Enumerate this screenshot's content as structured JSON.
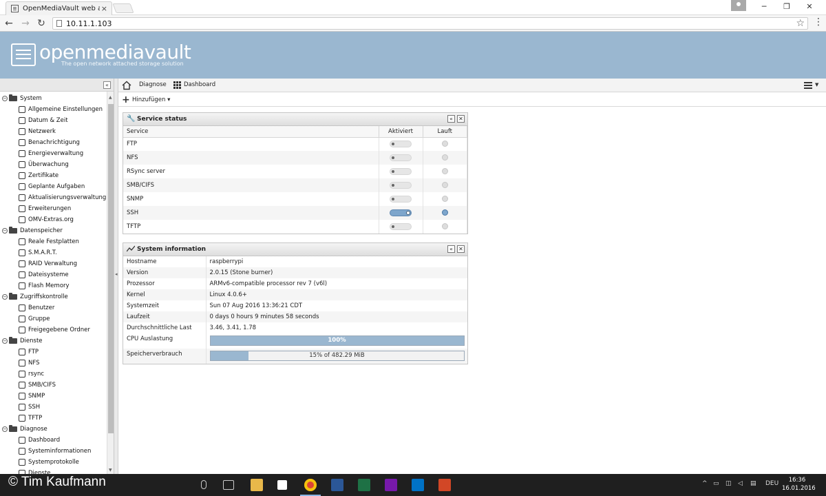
{
  "browser": {
    "tab_title": "OpenMediaVault web administration",
    "close_glyph": "×",
    "url": "10.11.1.103",
    "back_glyph": "←",
    "forward_glyph": "→",
    "reload_glyph": "↻",
    "star_glyph": "☆",
    "menu_glyph": "⋮",
    "minimize_glyph": "─",
    "restore_glyph": "❐",
    "window_close_glyph": "✕"
  },
  "header": {
    "logo_text": "openmediavault",
    "tagline": "The open network attached storage solution"
  },
  "sidebar": {
    "collapse_glyph": "«",
    "groups": [
      {
        "label": "System",
        "items": [
          {
            "label": "Allgemeine Einstellungen",
            "icon": "gears-icon"
          },
          {
            "label": "Datum & Zeit",
            "icon": "clock-icon"
          },
          {
            "label": "Netzwerk",
            "icon": "network-icon"
          },
          {
            "label": "Benachrichtigung",
            "icon": "mail-icon"
          },
          {
            "label": "Energieverwaltung",
            "icon": "power-icon"
          },
          {
            "label": "Überwachung",
            "icon": "chart-line-icon"
          },
          {
            "label": "Zertifikate",
            "icon": "certificate-icon"
          },
          {
            "label": "Geplante Aufgaben",
            "icon": "alarm-icon"
          },
          {
            "label": "Aktualisierungsverwaltung",
            "icon": "update-icon"
          },
          {
            "label": "Erweiterungen",
            "icon": "puzzle-icon"
          },
          {
            "label": "OMV-Extras.org",
            "icon": "plug-icon"
          }
        ]
      },
      {
        "label": "Datenspeicher",
        "items": [
          {
            "label": "Reale Festplatten",
            "icon": "disk-icon"
          },
          {
            "label": "S.M.A.R.T.",
            "icon": "smart-icon"
          },
          {
            "label": "RAID Verwaltung",
            "icon": "raid-icon"
          },
          {
            "label": "Dateisysteme",
            "icon": "filesystem-icon"
          },
          {
            "label": "Flash Memory",
            "icon": "flash-icon"
          }
        ]
      },
      {
        "label": "Zugriffskontrolle",
        "items": [
          {
            "label": "Benutzer",
            "icon": "user-icon"
          },
          {
            "label": "Gruppe",
            "icon": "group-icon"
          },
          {
            "label": "Freigegebene Ordner",
            "icon": "share-icon"
          }
        ]
      },
      {
        "label": "Dienste",
        "items": [
          {
            "label": "FTP",
            "icon": "ftp-icon"
          },
          {
            "label": "NFS",
            "icon": "nfs-icon"
          },
          {
            "label": "rsync",
            "icon": "rsync-icon"
          },
          {
            "label": "SMB/CIFS",
            "icon": "windows-icon"
          },
          {
            "label": "SNMP",
            "icon": "snmp-icon"
          },
          {
            "label": "SSH",
            "icon": "terminal-icon"
          },
          {
            "label": "TFTP",
            "icon": "tftp-icon"
          }
        ]
      },
      {
        "label": "Diagnose",
        "items": [
          {
            "label": "Dashboard",
            "icon": "grid-icon"
          },
          {
            "label": "Systeminformationen",
            "icon": "chart-line-icon"
          },
          {
            "label": "Systemprotokolle",
            "icon": "log-icon"
          },
          {
            "label": "Dienste",
            "icon": "services-icon"
          }
        ]
      }
    ]
  },
  "breadcrumb": {
    "items": [
      "Diagnose",
      "Dashboard"
    ]
  },
  "toolbar": {
    "add_label": "Hinzufügen",
    "add_caret": "▾",
    "plus_glyph": "+"
  },
  "service_status": {
    "title": "Service status",
    "columns": [
      "Service",
      "Aktiviert",
      "Lauft"
    ],
    "rows": [
      {
        "service": "FTP",
        "enabled": false,
        "running": false
      },
      {
        "service": "NFS",
        "enabled": false,
        "running": false
      },
      {
        "service": "RSync server",
        "enabled": false,
        "running": false
      },
      {
        "service": "SMB/CIFS",
        "enabled": false,
        "running": false
      },
      {
        "service": "SNMP",
        "enabled": false,
        "running": false
      },
      {
        "service": "SSH",
        "enabled": true,
        "running": true
      },
      {
        "service": "TFTP",
        "enabled": false,
        "running": false
      }
    ]
  },
  "system_info": {
    "title": "System information",
    "rows": [
      {
        "key": "Hostname",
        "value": "raspberrypi"
      },
      {
        "key": "Version",
        "value": "2.0.15 (Stone burner)"
      },
      {
        "key": "Prozessor",
        "value": "ARMv6-compatible processor rev 7 (v6l)"
      },
      {
        "key": "Kernel",
        "value": "Linux 4.0.6+"
      },
      {
        "key": "Systemzeit",
        "value": "Sun 07 Aug 2016 13:36:21 CDT"
      },
      {
        "key": "Laufzeit",
        "value": "0 days 0 hours 9 minutes 58 seconds"
      },
      {
        "key": "Durchschnittliche Last",
        "value": "3.46, 3.41, 1.78"
      }
    ],
    "cpu": {
      "key": "CPU Auslastung",
      "label": "100%",
      "fraction": 1.0
    },
    "memory": {
      "key": "Speicherverbrauch",
      "label": "15% of 482.29 MiB",
      "fraction": 0.15
    }
  },
  "panel_buttons": {
    "collapse": "«",
    "close": "✕"
  },
  "taskbar": {
    "watermark": "© Tim Kaufmann",
    "tray_lang": "DEU",
    "time": "16:36",
    "date": "16.01.2016"
  },
  "colors": {
    "header_bg": "#9ab7d0",
    "accent": "#7ea6cc"
  }
}
